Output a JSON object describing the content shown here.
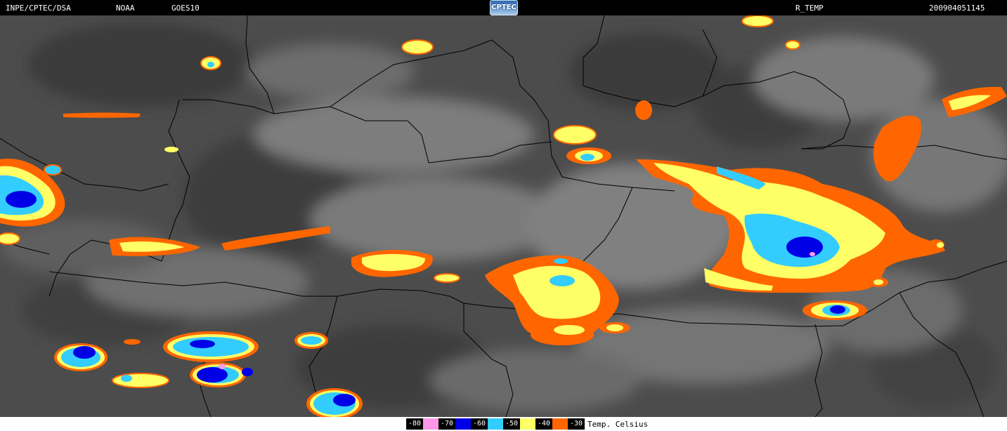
{
  "header": {
    "source": "INPE/CPTEC/DSA",
    "agency": "NOAA",
    "satellite": "GOES10",
    "logo_text": "CPTEC",
    "product": "R_TEMP",
    "timestamp": "200904051145"
  },
  "legend": {
    "unit": "Temp. Celsius",
    "items": [
      {
        "label": "-80",
        "color": "#ff99e6"
      },
      {
        "label": "-70",
        "color": "#0000e6"
      },
      {
        "label": "-60",
        "color": "#33ccff"
      },
      {
        "label": "-50",
        "color": "#ffff66"
      },
      {
        "label": "-40",
        "color": "#ff6600"
      },
      {
        "label": "-30",
        "color": ""
      }
    ]
  },
  "colors": {
    "background": "#4a4a4a",
    "cloud": "#9a9a9a",
    "border_line": "#000000"
  }
}
